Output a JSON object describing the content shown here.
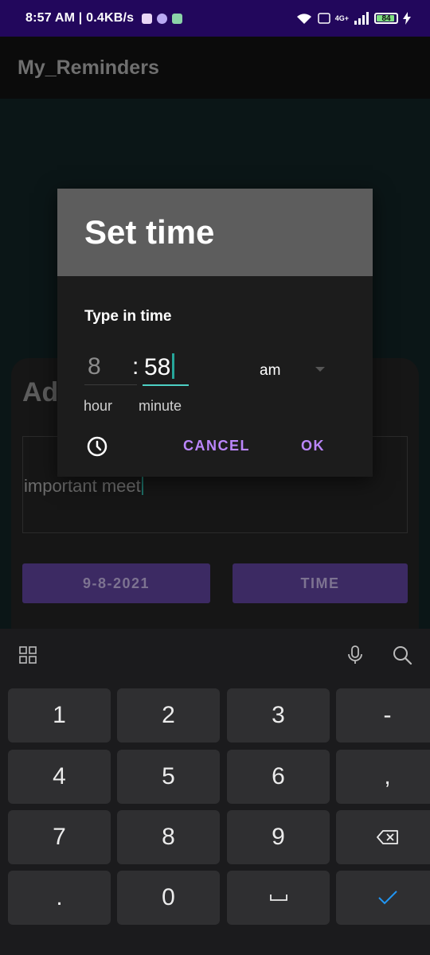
{
  "status_bar": {
    "time": "8:57 AM | 0.4KB/s",
    "network_tag": "4G+",
    "battery": "84"
  },
  "app_bar": {
    "title": "My_Reminders"
  },
  "form": {
    "title": "Ad",
    "note_text": "important meet",
    "date_button": "9-8-2021",
    "time_button": "TIME"
  },
  "dialog": {
    "title": "Set time",
    "subtitle": "Type in time",
    "hour_value": "8",
    "separator": ":",
    "minute_value": "58",
    "ampm_value": "am",
    "hour_label": "hour",
    "minute_label": "minute",
    "cancel": "CANCEL",
    "ok": "OK",
    "clock_icon": "clock-icon"
  },
  "keyboard": {
    "rows": [
      [
        "1",
        "2",
        "3",
        "-"
      ],
      [
        "4",
        "5",
        "6",
        ","
      ],
      [
        "7",
        "8",
        "9",
        "backspace"
      ],
      [
        ".",
        "0",
        "space",
        "done"
      ]
    ],
    "toolbar_icons": [
      "grid-icon",
      "mic-icon",
      "search-icon"
    ],
    "done_color": "#2196f3"
  },
  "colors": {
    "status_bar": "#22075c",
    "accent": "#bb86fc",
    "teal": "#4dd0c4",
    "button_purple": "#3c2a63"
  }
}
